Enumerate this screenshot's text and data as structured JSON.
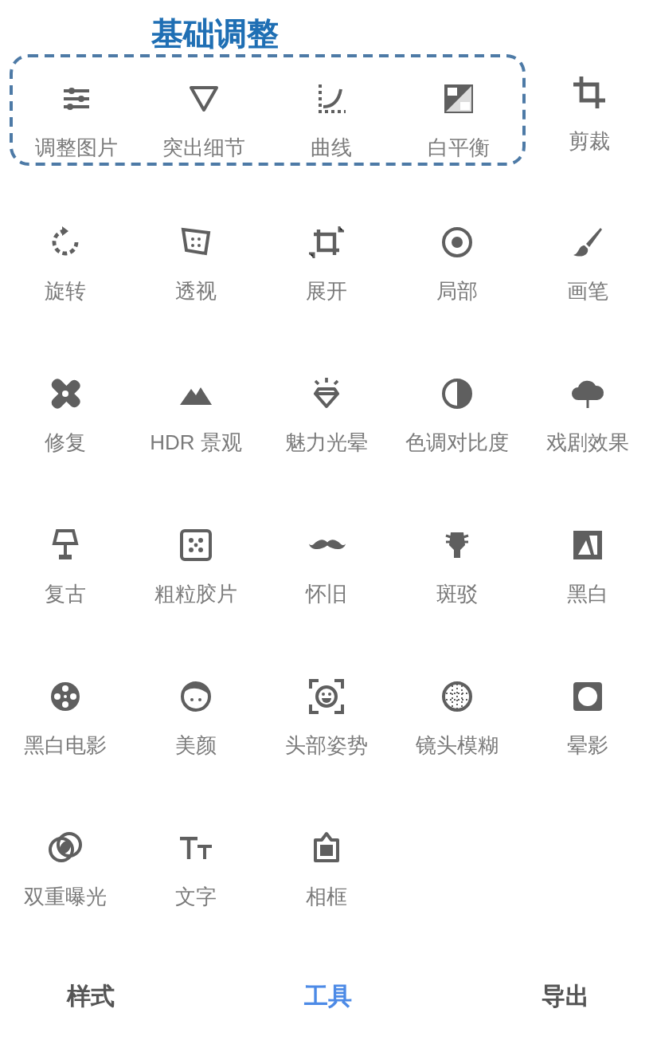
{
  "highlighted_group": {
    "title": "基础调整",
    "tools": [
      {
        "label": "调整图片"
      },
      {
        "label": "突出细节"
      },
      {
        "label": "曲线"
      },
      {
        "label": "白平衡"
      }
    ]
  },
  "tools": [
    {
      "label": "剪裁"
    },
    {
      "label": "旋转"
    },
    {
      "label": "透视"
    },
    {
      "label": "展开"
    },
    {
      "label": "局部"
    },
    {
      "label": "画笔"
    },
    {
      "label": "修复"
    },
    {
      "label": "HDR 景观"
    },
    {
      "label": "魅力光晕"
    },
    {
      "label": "色调对比度"
    },
    {
      "label": "戏剧效果"
    },
    {
      "label": "复古"
    },
    {
      "label": "粗粒胶片"
    },
    {
      "label": "怀旧"
    },
    {
      "label": "斑驳"
    },
    {
      "label": "黑白"
    },
    {
      "label": "黑白电影"
    },
    {
      "label": "美颜"
    },
    {
      "label": "头部姿势"
    },
    {
      "label": "镜头模糊"
    },
    {
      "label": "晕影"
    },
    {
      "label": "双重曝光"
    },
    {
      "label": "文字"
    },
    {
      "label": "相框"
    }
  ],
  "tabs": [
    {
      "label": "样式",
      "selected": false
    },
    {
      "label": "工具",
      "selected": true
    },
    {
      "label": "导出",
      "selected": false
    }
  ]
}
